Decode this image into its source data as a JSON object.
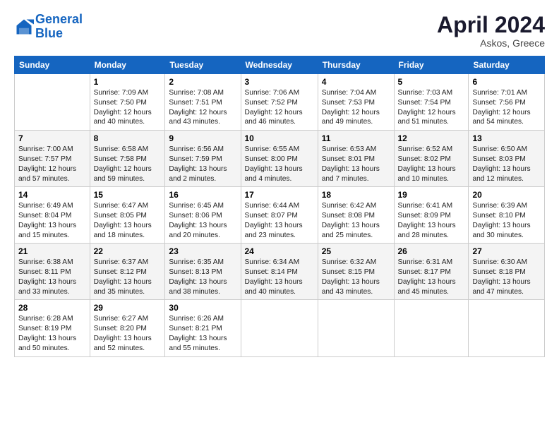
{
  "header": {
    "logo_line1": "General",
    "logo_line2": "Blue",
    "month": "April 2024",
    "location": "Askos, Greece"
  },
  "columns": [
    "Sunday",
    "Monday",
    "Tuesday",
    "Wednesday",
    "Thursday",
    "Friday",
    "Saturday"
  ],
  "weeks": [
    [
      {
        "day": "",
        "info": ""
      },
      {
        "day": "1",
        "info": "Sunrise: 7:09 AM\nSunset: 7:50 PM\nDaylight: 12 hours\nand 40 minutes."
      },
      {
        "day": "2",
        "info": "Sunrise: 7:08 AM\nSunset: 7:51 PM\nDaylight: 12 hours\nand 43 minutes."
      },
      {
        "day": "3",
        "info": "Sunrise: 7:06 AM\nSunset: 7:52 PM\nDaylight: 12 hours\nand 46 minutes."
      },
      {
        "day": "4",
        "info": "Sunrise: 7:04 AM\nSunset: 7:53 PM\nDaylight: 12 hours\nand 49 minutes."
      },
      {
        "day": "5",
        "info": "Sunrise: 7:03 AM\nSunset: 7:54 PM\nDaylight: 12 hours\nand 51 minutes."
      },
      {
        "day": "6",
        "info": "Sunrise: 7:01 AM\nSunset: 7:56 PM\nDaylight: 12 hours\nand 54 minutes."
      }
    ],
    [
      {
        "day": "7",
        "info": "Sunrise: 7:00 AM\nSunset: 7:57 PM\nDaylight: 12 hours\nand 57 minutes."
      },
      {
        "day": "8",
        "info": "Sunrise: 6:58 AM\nSunset: 7:58 PM\nDaylight: 12 hours\nand 59 minutes."
      },
      {
        "day": "9",
        "info": "Sunrise: 6:56 AM\nSunset: 7:59 PM\nDaylight: 13 hours\nand 2 minutes."
      },
      {
        "day": "10",
        "info": "Sunrise: 6:55 AM\nSunset: 8:00 PM\nDaylight: 13 hours\nand 4 minutes."
      },
      {
        "day": "11",
        "info": "Sunrise: 6:53 AM\nSunset: 8:01 PM\nDaylight: 13 hours\nand 7 minutes."
      },
      {
        "day": "12",
        "info": "Sunrise: 6:52 AM\nSunset: 8:02 PM\nDaylight: 13 hours\nand 10 minutes."
      },
      {
        "day": "13",
        "info": "Sunrise: 6:50 AM\nSunset: 8:03 PM\nDaylight: 13 hours\nand 12 minutes."
      }
    ],
    [
      {
        "day": "14",
        "info": "Sunrise: 6:49 AM\nSunset: 8:04 PM\nDaylight: 13 hours\nand 15 minutes."
      },
      {
        "day": "15",
        "info": "Sunrise: 6:47 AM\nSunset: 8:05 PM\nDaylight: 13 hours\nand 18 minutes."
      },
      {
        "day": "16",
        "info": "Sunrise: 6:45 AM\nSunset: 8:06 PM\nDaylight: 13 hours\nand 20 minutes."
      },
      {
        "day": "17",
        "info": "Sunrise: 6:44 AM\nSunset: 8:07 PM\nDaylight: 13 hours\nand 23 minutes."
      },
      {
        "day": "18",
        "info": "Sunrise: 6:42 AM\nSunset: 8:08 PM\nDaylight: 13 hours\nand 25 minutes."
      },
      {
        "day": "19",
        "info": "Sunrise: 6:41 AM\nSunset: 8:09 PM\nDaylight: 13 hours\nand 28 minutes."
      },
      {
        "day": "20",
        "info": "Sunrise: 6:39 AM\nSunset: 8:10 PM\nDaylight: 13 hours\nand 30 minutes."
      }
    ],
    [
      {
        "day": "21",
        "info": "Sunrise: 6:38 AM\nSunset: 8:11 PM\nDaylight: 13 hours\nand 33 minutes."
      },
      {
        "day": "22",
        "info": "Sunrise: 6:37 AM\nSunset: 8:12 PM\nDaylight: 13 hours\nand 35 minutes."
      },
      {
        "day": "23",
        "info": "Sunrise: 6:35 AM\nSunset: 8:13 PM\nDaylight: 13 hours\nand 38 minutes."
      },
      {
        "day": "24",
        "info": "Sunrise: 6:34 AM\nSunset: 8:14 PM\nDaylight: 13 hours\nand 40 minutes."
      },
      {
        "day": "25",
        "info": "Sunrise: 6:32 AM\nSunset: 8:15 PM\nDaylight: 13 hours\nand 43 minutes."
      },
      {
        "day": "26",
        "info": "Sunrise: 6:31 AM\nSunset: 8:17 PM\nDaylight: 13 hours\nand 45 minutes."
      },
      {
        "day": "27",
        "info": "Sunrise: 6:30 AM\nSunset: 8:18 PM\nDaylight: 13 hours\nand 47 minutes."
      }
    ],
    [
      {
        "day": "28",
        "info": "Sunrise: 6:28 AM\nSunset: 8:19 PM\nDaylight: 13 hours\nand 50 minutes."
      },
      {
        "day": "29",
        "info": "Sunrise: 6:27 AM\nSunset: 8:20 PM\nDaylight: 13 hours\nand 52 minutes."
      },
      {
        "day": "30",
        "info": "Sunrise: 6:26 AM\nSunset: 8:21 PM\nDaylight: 13 hours\nand 55 minutes."
      },
      {
        "day": "",
        "info": ""
      },
      {
        "day": "",
        "info": ""
      },
      {
        "day": "",
        "info": ""
      },
      {
        "day": "",
        "info": ""
      }
    ]
  ]
}
